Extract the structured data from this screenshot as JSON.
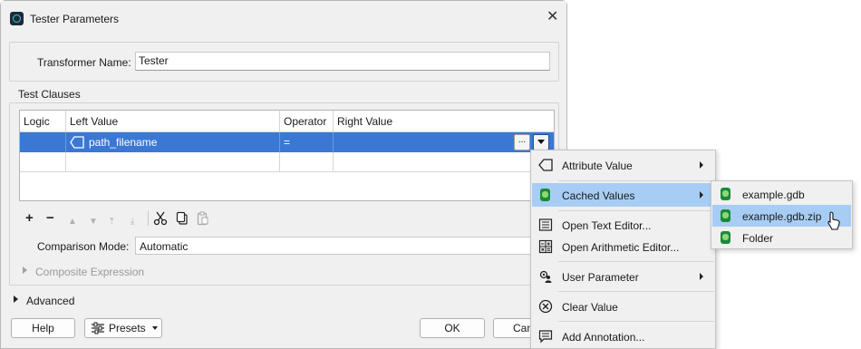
{
  "dialog": {
    "title": "Tester Parameters",
    "close_glyph": "✕",
    "transformer_name_label": "Transformer Name:",
    "transformer_name_value": "Tester"
  },
  "test_clauses": {
    "group_label": "Test Clauses",
    "columns": [
      "Logic",
      "Left Value",
      "Operator",
      "Right Value"
    ],
    "rows": [
      {
        "logic": "",
        "left_value": "path_filename",
        "operator": "=",
        "right_value": ""
      }
    ],
    "ellipsis_label": "...",
    "toolbar": {
      "add": "+",
      "remove": "−",
      "move_up": "▲",
      "move_down": "▼",
      "move_top": "⤒",
      "move_bottom": "⤓",
      "cut_icon": "cut-icon",
      "copy_icon": "copy-icon",
      "paste_icon": "paste-icon"
    },
    "comparison_mode_label": "Comparison Mode:",
    "comparison_mode_value": "Automatic",
    "composite_expression_label": "Composite Expression"
  },
  "advanced_label": "Advanced",
  "buttons": {
    "help": "Help",
    "presets": "Presets",
    "ok": "OK",
    "cancel": "Canc"
  },
  "context_menu": {
    "items": [
      {
        "label": "Attribute Value",
        "icon": "attribute-icon",
        "submenu": true
      },
      {
        "label": "Cached Values",
        "icon": "database-icon",
        "submenu": true,
        "highlighted": true
      },
      {
        "label": "Open Text Editor...",
        "icon": "text-editor-icon",
        "submenu": false
      },
      {
        "label": "Open Arithmetic Editor...",
        "icon": "calculator-icon",
        "submenu": false
      },
      {
        "label": "User Parameter",
        "icon": "user-parameter-icon",
        "submenu": true
      },
      {
        "label": "Clear Value",
        "icon": "clear-icon",
        "submenu": false
      },
      {
        "label": "Add Annotation...",
        "icon": "annotation-icon",
        "submenu": false
      }
    ]
  },
  "cached_submenu": {
    "items": [
      {
        "label": "example.gdb",
        "icon": "database-icon"
      },
      {
        "label": "example.gdb.zip",
        "icon": "database-icon",
        "highlighted": true
      },
      {
        "label": "Folder",
        "icon": "database-icon"
      }
    ]
  },
  "colors": {
    "selection_blue": "#3a78d4",
    "menu_highlight": "#a8cdf5",
    "dialog_bg": "#f0f0f0",
    "database_green": "#1a8a3a"
  }
}
